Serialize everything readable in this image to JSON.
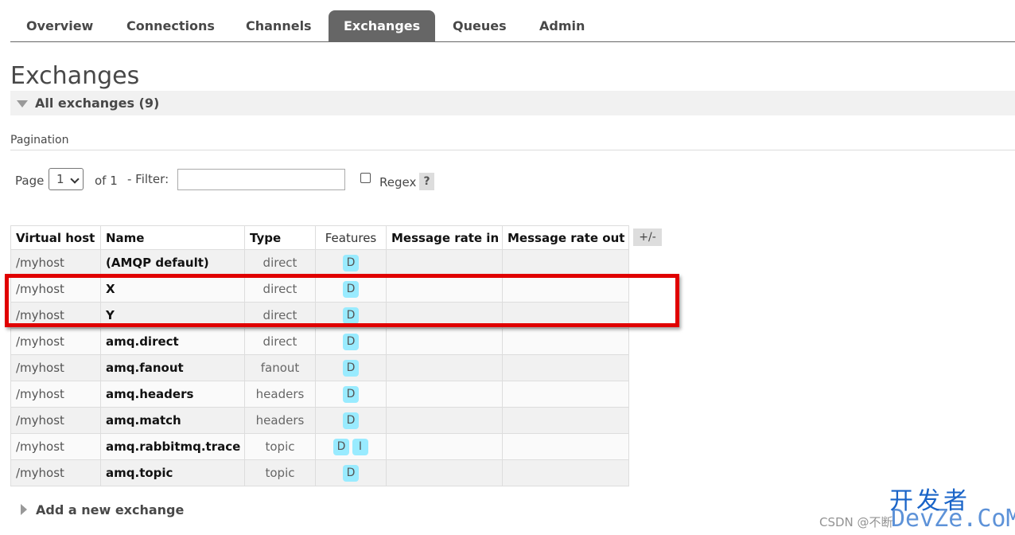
{
  "nav": {
    "tabs": [
      {
        "label": "Overview"
      },
      {
        "label": "Connections"
      },
      {
        "label": "Channels"
      },
      {
        "label": "Exchanges"
      },
      {
        "label": "Queues"
      },
      {
        "label": "Admin"
      }
    ],
    "active": "Exchanges"
  },
  "page": {
    "title": "Exchanges",
    "section_label": "All exchanges (9)"
  },
  "pagination": {
    "title": "Pagination",
    "page_label": "Page",
    "page_value": "1",
    "of_label": "of 1",
    "filter_label": "- Filter:",
    "filter_value": "",
    "regex_label": "Regex",
    "regex_checked": false,
    "help_label": "?"
  },
  "table": {
    "headers": [
      "Virtual host",
      "Name",
      "Type",
      "Features",
      "Message rate in",
      "Message rate out"
    ],
    "columns_toggle": "+/-",
    "rows": [
      {
        "vhost": "/myhost",
        "name": "(AMQP default)",
        "type": "direct",
        "features": [
          "D"
        ],
        "rate_in": "",
        "rate_out": ""
      },
      {
        "vhost": "/myhost",
        "name": "X",
        "type": "direct",
        "features": [
          "D"
        ],
        "rate_in": "",
        "rate_out": ""
      },
      {
        "vhost": "/myhost",
        "name": "Y",
        "type": "direct",
        "features": [
          "D"
        ],
        "rate_in": "",
        "rate_out": ""
      },
      {
        "vhost": "/myhost",
        "name": "amq.direct",
        "type": "direct",
        "features": [
          "D"
        ],
        "rate_in": "",
        "rate_out": ""
      },
      {
        "vhost": "/myhost",
        "name": "amq.fanout",
        "type": "fanout",
        "features": [
          "D"
        ],
        "rate_in": "",
        "rate_out": ""
      },
      {
        "vhost": "/myhost",
        "name": "amq.headers",
        "type": "headers",
        "features": [
          "D"
        ],
        "rate_in": "",
        "rate_out": ""
      },
      {
        "vhost": "/myhost",
        "name": "amq.match",
        "type": "headers",
        "features": [
          "D"
        ],
        "rate_in": "",
        "rate_out": ""
      },
      {
        "vhost": "/myhost",
        "name": "amq.rabbitmq.trace",
        "type": "topic",
        "features": [
          "D",
          "I"
        ],
        "rate_in": "",
        "rate_out": ""
      },
      {
        "vhost": "/myhost",
        "name": "amq.topic",
        "type": "topic",
        "features": [
          "D"
        ],
        "rate_in": "",
        "rate_out": ""
      }
    ]
  },
  "add_section": {
    "label": "Add a new exchange"
  },
  "watermark": {
    "logo": "开发者",
    "csdn": "CSDN @不断",
    "site": "DevZe.CoM"
  },
  "colors": {
    "active_tab": "#666666",
    "badge": "#99ebff",
    "highlight": "#e00000"
  }
}
